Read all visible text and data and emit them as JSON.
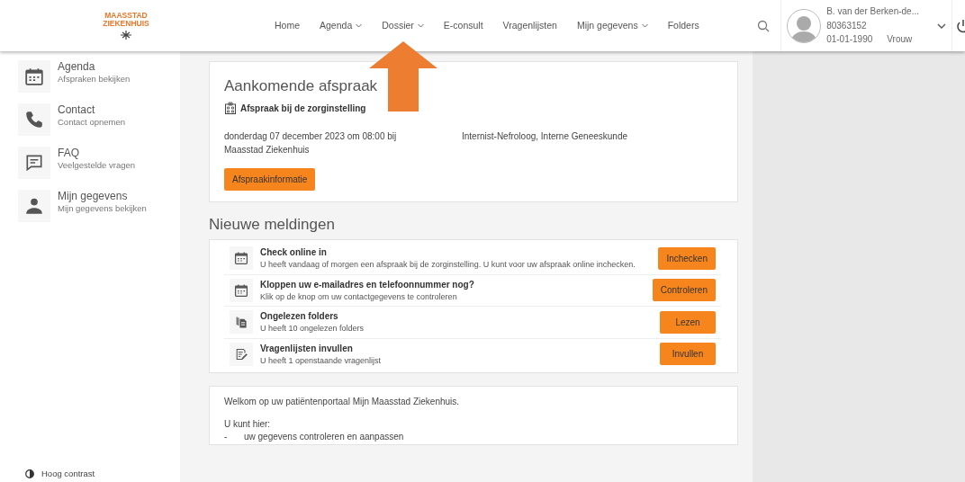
{
  "logo": {
    "line_1": "MAASSTAD",
    "line_2": "ZIEKENHUIS"
  },
  "nav": [
    {
      "label": "Home",
      "dropdown": false
    },
    {
      "label": "Agenda",
      "dropdown": true
    },
    {
      "label": "Dossier",
      "dropdown": true
    },
    {
      "label": "E-consult",
      "dropdown": false
    },
    {
      "label": "Vragenlijsten",
      "dropdown": false
    },
    {
      "label": "Mijn gegevens",
      "dropdown": true
    },
    {
      "label": "Folders",
      "dropdown": false
    }
  ],
  "profile": {
    "name": "B. van der Berken-de...",
    "number": "80363152",
    "birth_date": "01-01-1990",
    "gender": "Vrouw"
  },
  "sidebar": {
    "items": [
      {
        "kind": "calendar",
        "title": "Agenda",
        "subtitle": "Afspraken bekijken"
      },
      {
        "kind": "phone",
        "title": "Contact",
        "subtitle": "Contact opnemen"
      },
      {
        "kind": "chat",
        "title": "FAQ",
        "subtitle": "Veelgestelde vragen"
      },
      {
        "kind": "person",
        "title": "Mijn gegevens",
        "subtitle": "Mijn gegevens bekijken"
      }
    ],
    "contrast_toggle": "Hoog contrast"
  },
  "appointment": {
    "heading": "Aankomende afspraak",
    "type": "Afspraak bij de zorginstelling",
    "when": "donderdag 07 december 2023 om 08:00 bij",
    "location": "Maasstad Ziekenhuis",
    "specialty": "Internist-Nefroloog, Interne Geneeskunde",
    "button": "Afspraakinformatie"
  },
  "notifications": {
    "heading": "Nieuwe meldingen",
    "items": [
      {
        "kind": "calendar",
        "title": "Check online in",
        "text": "U heeft vandaag of morgen een afspraak bij de zorginstelling. U kunt voor uw afspraak online inchecken.",
        "button": "Inchecken"
      },
      {
        "kind": "calendar",
        "title": "Kloppen uw e-mailadres en telefoonnummer nog?",
        "text": "Klik op de knop om uw contactgegevens te controleren",
        "button": "Controleren"
      },
      {
        "kind": "folders",
        "title": "Ongelezen folders",
        "text": "U heeft 10 ongelezen folders",
        "button": "Lezen"
      },
      {
        "kind": "form",
        "title": "Vragenlijsten invullen",
        "text": "U heeft 1 openstaande vragenlijst",
        "button": "Invullen"
      }
    ]
  },
  "welcome": {
    "intro": "Welkom op uw patiëntenportaal Mijn Maasstad Ziekenhuis.",
    "lead": "U kunt hier:",
    "bullets": [
      {
        "mark": "-",
        "text": "uw gegevens controleren en aanpassen"
      }
    ]
  }
}
